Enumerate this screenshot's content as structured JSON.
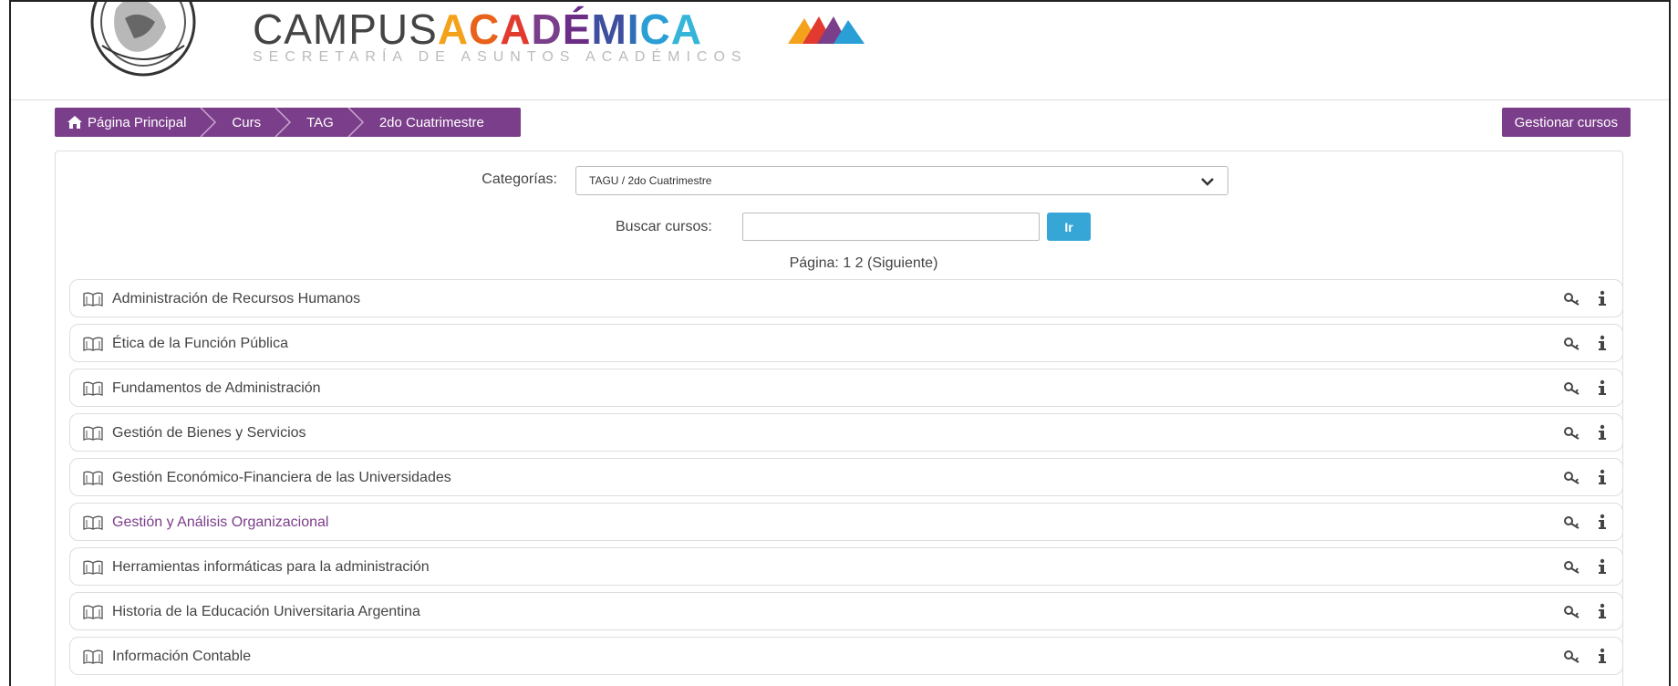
{
  "header": {
    "brand_campus": "CAMPUS",
    "brand_academica": [
      "A",
      "C",
      "A",
      "D",
      "É",
      "M",
      "I",
      "C",
      "A"
    ],
    "brand_academica_colors": [
      "#f4a21b",
      "#e8621c",
      "#e23a2e",
      "#7b3e8a",
      "#6b2d86",
      "#3f4fa0",
      "#2f6fb5",
      "#2a9fd6",
      "#35b5d8"
    ],
    "brand_subtitle": "SECRETARÍA DE ASUNTOS ACADÉMICOS",
    "logo_colors": [
      "#f4a21b",
      "#e23a2e",
      "#7b3e8a",
      "#2a9fd6"
    ]
  },
  "breadcrumb": {
    "items": [
      {
        "label": "Página Principal",
        "icon": "home-icon"
      },
      {
        "label": "Curs"
      },
      {
        "label": "TAG"
      },
      {
        "label": "2do Cuatrimestre"
      }
    ]
  },
  "actions": {
    "manage_label": "Gestionar cursos"
  },
  "filters": {
    "category_label": "Categorías:",
    "category_value": "TAGU / 2do Cuatrimestre",
    "search_label": "Buscar cursos:",
    "search_value": "",
    "go_label": "Ir"
  },
  "pager": {
    "prefix": "Página:",
    "page1": "1",
    "page2": "2",
    "next": "(Siguiente)"
  },
  "courses": [
    {
      "name": "Administración de Recursos Humanos",
      "visited": false
    },
    {
      "name": "Ética de la Función Pública",
      "visited": false
    },
    {
      "name": "Fundamentos de Administración",
      "visited": false
    },
    {
      "name": "Gestión de Bienes y Servicios",
      "visited": false
    },
    {
      "name": "Gestión Económico-Financiera de las Universidades",
      "visited": false
    },
    {
      "name": "Gestión y Análisis Organizacional",
      "visited": true
    },
    {
      "name": "Herramientas informáticas para la administración",
      "visited": false
    },
    {
      "name": "Historia de la Educación Universitaria Argentina",
      "visited": false
    },
    {
      "name": "Información Contable",
      "visited": false
    }
  ],
  "colors": {
    "accent": "#7b3e8a",
    "go_button": "#35a6d6",
    "visited_link": "#7b3e8a"
  }
}
